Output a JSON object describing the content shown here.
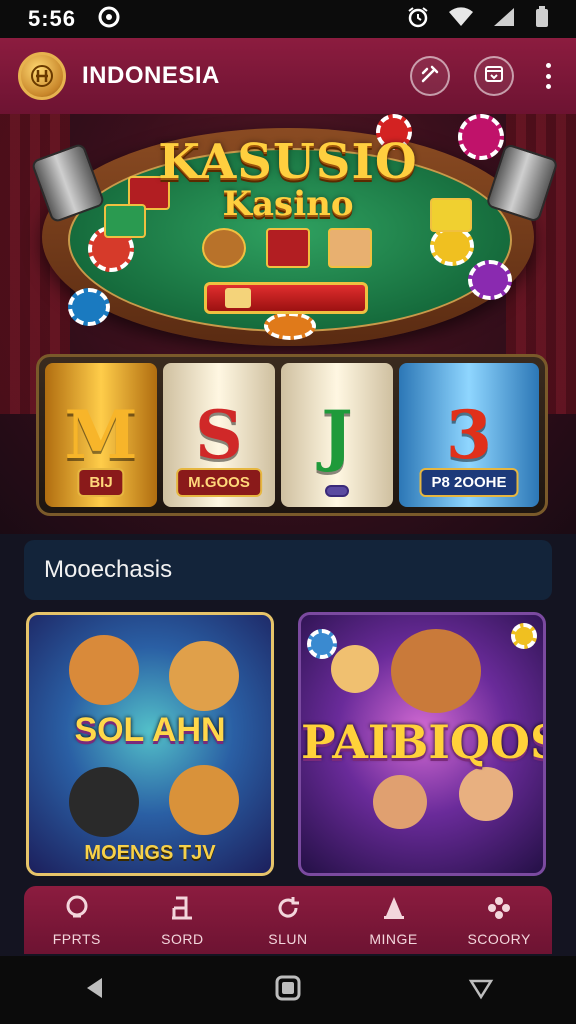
{
  "status_bar": {
    "time": "5:56"
  },
  "app_bar": {
    "title": "INDONESIA",
    "logo_icon": "coin-logo-icon"
  },
  "hero": {
    "title_main": "KASUSIO",
    "title_sub": "Kasino"
  },
  "reels": [
    {
      "symbol": "M",
      "label": "BIJ"
    },
    {
      "symbol": "S",
      "label": "M.GOOS"
    },
    {
      "symbol": "J",
      "label": ""
    },
    {
      "symbol": "3",
      "label": "P8 2OOHE"
    }
  ],
  "section": {
    "title": "Mooechasis"
  },
  "games": [
    {
      "name": "SOL AHN",
      "subtitle": "MOENGS  TJV"
    },
    {
      "name": "PAIBIQOS",
      "subtitle": ""
    }
  ],
  "bottom_nav": [
    {
      "label": "FPRTS",
      "icon": "balloon-icon"
    },
    {
      "label": "SORD",
      "icon": "seat-icon"
    },
    {
      "label": "SLUN",
      "icon": "refresh-icon"
    },
    {
      "label": "MINGE",
      "icon": "cone-icon"
    },
    {
      "label": "SCOORY",
      "icon": "flower-icon"
    }
  ],
  "colors": {
    "brand": "#7a1636",
    "accent": "#ffcf3f",
    "section_bg": "#13243a"
  }
}
